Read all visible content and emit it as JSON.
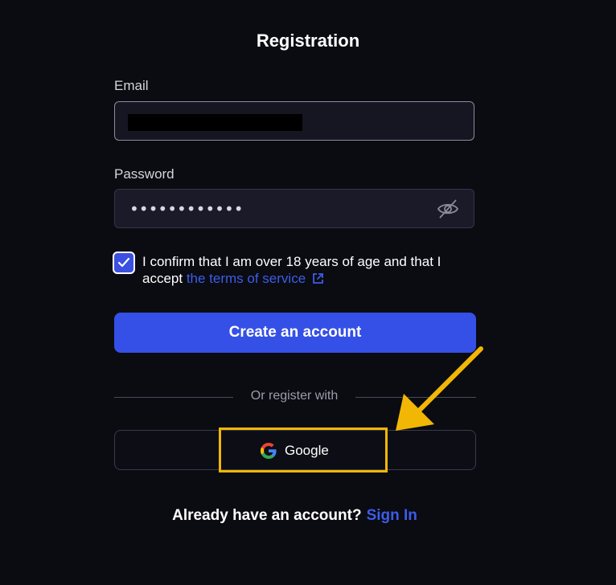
{
  "form": {
    "title": "Registration",
    "email_label": "Email",
    "email_value": "",
    "password_label": "Password",
    "password_value": "••••••••••••",
    "consent_text": "I confirm that I am over 18 years of age and that I accept",
    "terms_link": "the terms of service",
    "consent_checked": true,
    "create_button": "Create an account",
    "divider_text": "Or register with",
    "google_button": "Google",
    "signin_prompt": "Already have an account?",
    "signin_link": "Sign In"
  },
  "colors": {
    "background": "#0b0b12",
    "accent": "#3550e6",
    "link": "#3c5de8",
    "highlight": "#f2b705"
  },
  "icons": {
    "password_toggle": "eye-slash-icon",
    "terms_external": "external-link-icon",
    "google": "google-logo-icon",
    "checkbox": "checkmark-icon",
    "annotation": "arrow-icon"
  }
}
